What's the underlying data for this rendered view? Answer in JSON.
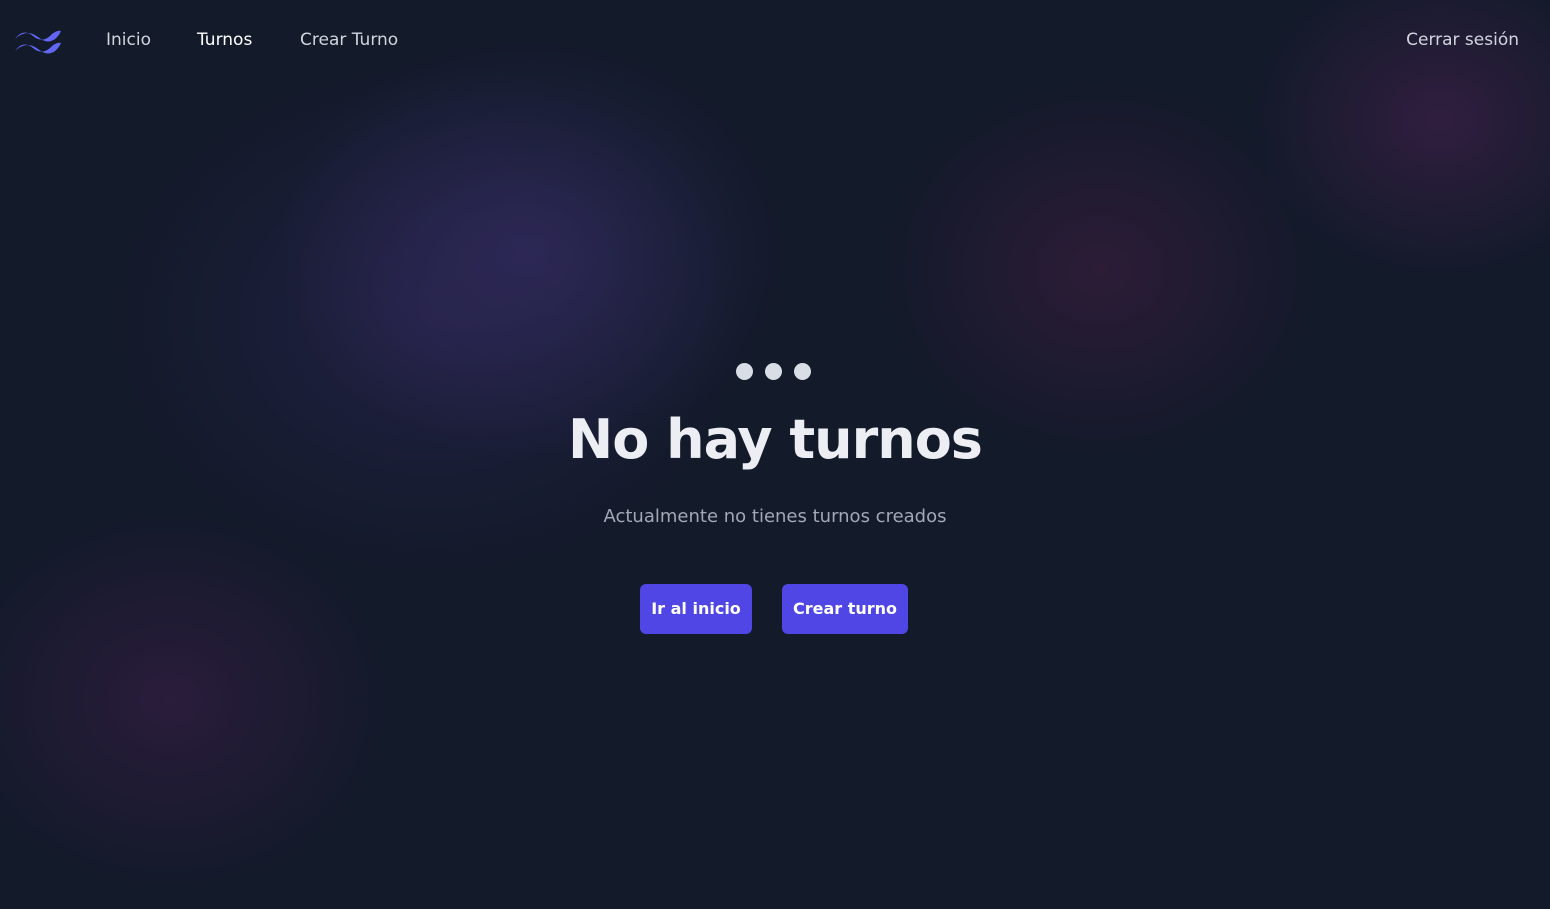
{
  "nav": {
    "logo_icon": "tailwind-waves-icon",
    "links": [
      {
        "label": "Inicio"
      },
      {
        "label": "Turnos"
      },
      {
        "label": "Crear Turno"
      }
    ],
    "logout_label": "Cerrar sesión"
  },
  "empty_state": {
    "icon": "ellipsis-icon",
    "title": "No hay turnos",
    "subtitle": "Actualmente no tienes turnos creados",
    "buttons": {
      "home_label": "Ir al inicio",
      "create_label": "Crear turno"
    }
  },
  "colors": {
    "accent": "#4f46e5",
    "background": "#131a2a",
    "logo": "#6366f1"
  }
}
